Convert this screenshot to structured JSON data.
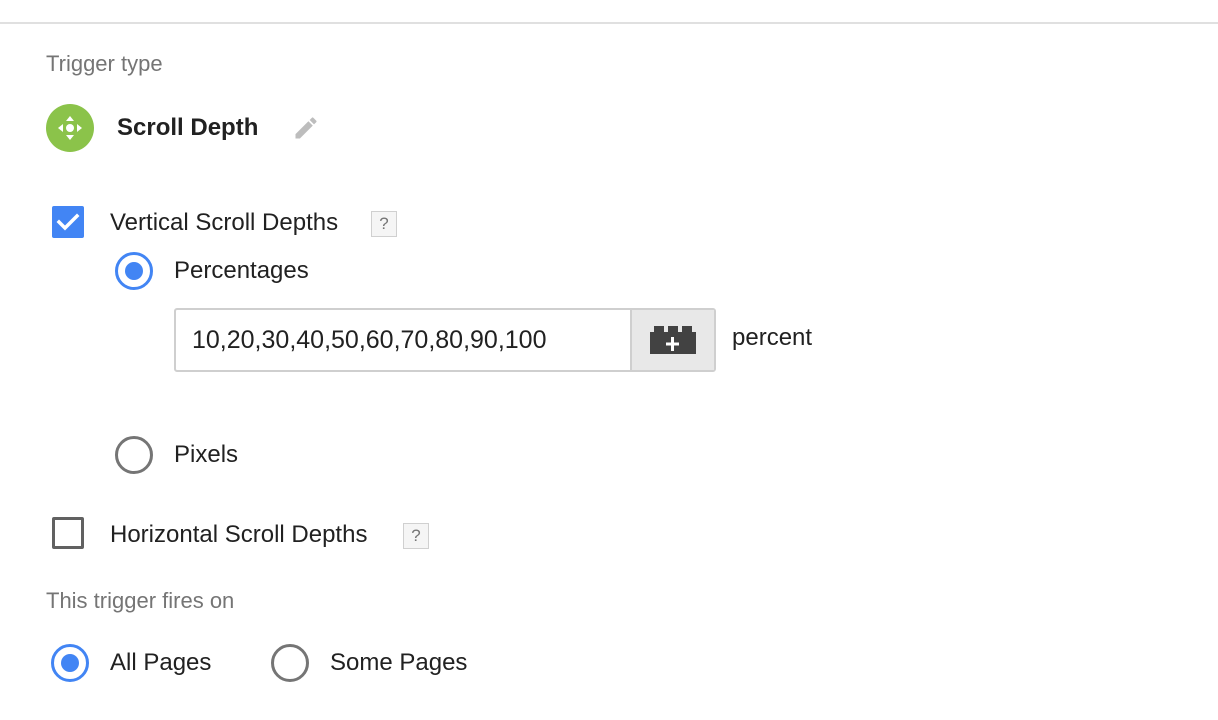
{
  "trigger": {
    "section_label": "Trigger type",
    "icon": "scroll-move-icon",
    "icon_color": "#8bc34a",
    "name": "Scroll Depth",
    "edit_icon": "pencil-icon"
  },
  "vertical": {
    "label": "Vertical Scroll Depths",
    "checked": true,
    "help": "?",
    "options": {
      "percentages": {
        "label": "Percentages",
        "selected": true
      },
      "pixels": {
        "label": "Pixels",
        "selected": false
      }
    },
    "input_value": "10,20,30,40,50,60,70,80,90,100",
    "variable_icon": "lego-add-icon",
    "unit": "percent"
  },
  "horizontal": {
    "label": "Horizontal Scroll Depths",
    "checked": false,
    "help": "?"
  },
  "fires_on": {
    "section_label": "This trigger fires on",
    "options": {
      "all_pages": {
        "label": "All Pages",
        "selected": true
      },
      "some_pages": {
        "label": "Some Pages",
        "selected": false
      }
    }
  },
  "colors": {
    "accent": "#4285f4",
    "trigger_icon_bg": "#8bc34a"
  }
}
